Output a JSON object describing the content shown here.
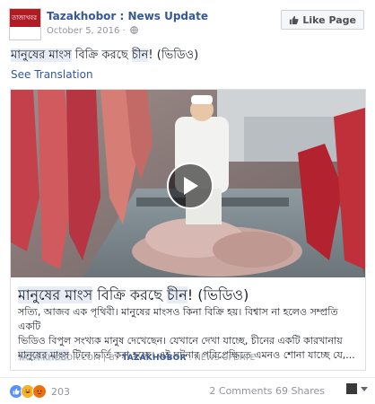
{
  "header": {
    "avatar_text": "তাজাখবর",
    "page_name": "Tazakhobor",
    "page_suffix": ": News Update",
    "date": "October 5, 2016 ·",
    "like_label": "Like Page"
  },
  "post": {
    "text_a": "মানুষের মাংস",
    "text_b": " বিক্রি করছে ",
    "text_c": "চীন",
    "text_d": "! (ভিডিও)",
    "see_translation": "See Translation"
  },
  "attachment": {
    "title_a": "মানুষের মাংস",
    "title_b": " বিক্রি করছে ",
    "title_c": "চীন",
    "title_d": "! (ভিডিও)",
    "desc_line1": "সত্যি, আজব এক পৃথিবী। মানুষের মাংসও কিনা বিক্রি হয়। বিশ্বাস না হলেও সম্প্রতি একটি",
    "desc_line2": "ভিডিও বিপুল সংখ্যক মানুষ দেখেছেন। যেখানে দেখা যাচ্ছে, চীনের একটি কারখানায়",
    "desc_line3a": "মানুষের মাংস",
    "desc_line3b": " টিনে ভর্তি করা হচ্ছে। এই ঘটনার পরিপ্রেক্ষিতে এমনও শোনা যাচ্ছে যে,...",
    "source_domain": "TAZA-KHOBOR.COM",
    "source_by": "| BY",
    "source_page": "TAZAKHOBOR",
    "source_suffix": ": NEWS UPDATE"
  },
  "footer": {
    "reaction_count": "203",
    "comments": "2 Comments",
    "shares": "69 Shares"
  },
  "colors": {
    "link_blue": "#365899",
    "logo_red": "#b01c24"
  },
  "icons": [
    "globe-icon",
    "like-thumb-icon",
    "play-icon",
    "like-reaction-icon",
    "haha-reaction-icon",
    "angry-reaction-icon",
    "caret-down-icon"
  ]
}
